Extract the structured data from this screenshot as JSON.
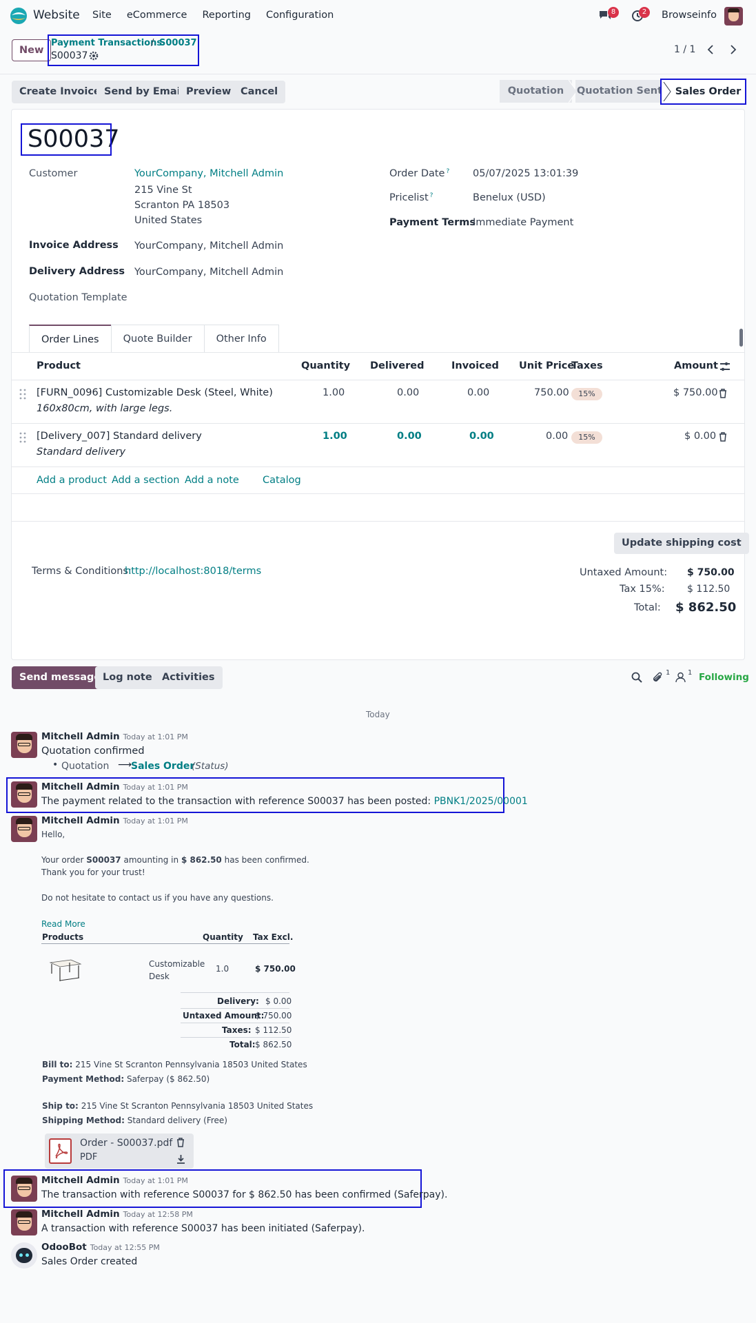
{
  "nav": {
    "app": "Website",
    "menu": [
      "Site",
      "eCommerce",
      "Reporting",
      "Configuration"
    ],
    "messages_count": "8",
    "activities_count": "2",
    "company": "Browseinfo"
  },
  "control": {
    "new_label": "New",
    "breadcrumb_parent": "Payment Transactions",
    "breadcrumb_sep": "/",
    "breadcrumb_current": "S00037",
    "record_name": "S00037",
    "pager": "1 / 1"
  },
  "actions": [
    "Create Invoice",
    "Send by Email",
    "Preview",
    "Cancel"
  ],
  "status": [
    "Quotation",
    "Quotation Sent",
    "Sales Order"
  ],
  "order": {
    "name": "S00037",
    "customer_label": "Customer",
    "customer": "YourCompany, Mitchell Admin",
    "address": [
      "215 Vine St",
      "Scranton PA 18503",
      "United States"
    ],
    "invoice_label": "Invoice Address",
    "invoice": "YourCompany, Mitchell Admin",
    "delivery_label": "Delivery Address",
    "delivery": "YourCompany, Mitchell Admin",
    "template_label": "Quotation Template",
    "date_label": "Order Date",
    "date": "05/07/2025 13:01:39",
    "pricelist_label": "Pricelist",
    "pricelist": "Benelux (USD)",
    "terms_label": "Payment Terms",
    "terms": "Immediate Payment",
    "help": "?"
  },
  "tabs": [
    "Order Lines",
    "Quote Builder",
    "Other Info"
  ],
  "lines": {
    "headers": [
      "Product",
      "Quantity",
      "Delivered",
      "Invoiced",
      "Unit Price",
      "Taxes",
      "Amount"
    ],
    "rows": [
      {
        "product": "[FURN_0096] Customizable Desk (Steel, White)",
        "desc": "160x80cm, with large legs.",
        "qty": "1.00",
        "delivered": "0.00",
        "invoiced": "0.00",
        "price": "750.00",
        "tax": "15%",
        "amount": "$ 750.00"
      },
      {
        "product": "[Delivery_007] Standard delivery",
        "desc": "Standard delivery",
        "qty": "1.00",
        "delivered": "0.00",
        "invoiced": "0.00",
        "price": "0.00",
        "tax": "15%",
        "amount": "$ 0.00"
      }
    ],
    "add": [
      "Add a product",
      "Add a section",
      "Add a note",
      "Catalog"
    ]
  },
  "totals": {
    "shipping_btn": "Update shipping cost",
    "terms_label": "Terms & Conditions:",
    "terms_link": "http://localhost:8018/terms",
    "untaxed_label": "Untaxed Amount:",
    "untaxed": "$ 750.00",
    "tax_label": "Tax 15%:",
    "tax": "$ 112.50",
    "total_label": "Total:",
    "total": "$ 862.50"
  },
  "chatter": {
    "send": "Send message",
    "log": "Log note",
    "activities": "Activities",
    "attach_count": "1",
    "follower_count": "1",
    "following": "Following",
    "date_sep": "Today"
  },
  "messages": [
    {
      "author": "Mitchell Admin",
      "time": "Today at 1:01 PM",
      "text": "Quotation confirmed",
      "track_from": "Quotation",
      "track_arrow": "⟶",
      "track_to": "Sales Order",
      "track_field": "(Status)"
    },
    {
      "author": "Mitchell Admin",
      "time": "Today at 1:01 PM",
      "text": "The payment related to the transaction with reference S00037 has been posted:",
      "link": "PBNK1/2025/00001"
    },
    {
      "author": "Mitchell Admin",
      "time": "Today at 1:01 PM"
    },
    {
      "author": "Mitchell Admin",
      "time": "Today at 1:01 PM",
      "text": "The transaction with reference S00037 for $ 862.50 has been confirmed (Saferpay)."
    },
    {
      "author": "Mitchell Admin",
      "time": "Today at 12:58 PM",
      "text": "A transaction with reference S00037 has been initiated (Saferpay)."
    },
    {
      "author": "OdooBot",
      "time": "Today at 12:55 PM",
      "text": "Sales Order created"
    }
  ],
  "email": {
    "hello": "Hello,",
    "order_pre": "Your order",
    "order_ref": "S00037",
    "order_mid": "amounting in",
    "order_amt": "$ 862.50",
    "order_post": "has been confirmed.",
    "thanks": "Thank you for your trust!",
    "contact": "Do not hesitate to contact us if you have any questions.",
    "read_more": "Read More",
    "th": [
      "Products",
      "Quantity",
      "Tax Excl."
    ],
    "product": "Customizable Desk",
    "qty": "1.0",
    "excl": "$ 750.00",
    "delivery_label": "Delivery:",
    "delivery": "$ 0.00",
    "untaxed_label": "Untaxed Amount:",
    "untaxed": "$ 750.00",
    "taxes_label": "Taxes:",
    "taxes": "$ 112.50",
    "total_label": "Total:",
    "total": "$ 862.50",
    "bill_label": "Bill to:",
    "bill": "215 Vine St Scranton Pennsylvania 18503 United States",
    "pay_label": "Payment Method:",
    "pay": "Saferpay ($ 862.50)",
    "ship_label": "Ship to:",
    "ship": "215 Vine St Scranton Pennsylvania 18503 United States",
    "method_label": "Shipping Method:",
    "method": "Standard delivery (Free)",
    "attachment": "Order - S00037.pdf",
    "attachment_type": "PDF"
  },
  "colors": {
    "accent": "#017e84",
    "primary": "#714b67",
    "highlight": "#1414d6"
  }
}
